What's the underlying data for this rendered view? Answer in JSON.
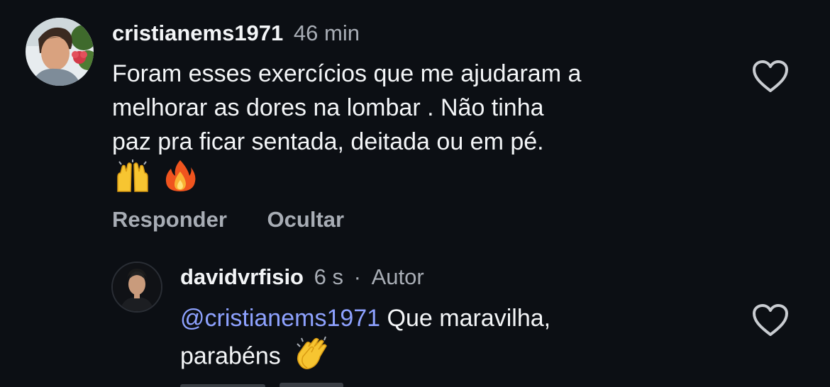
{
  "comments": [
    {
      "username": "cristianems1971",
      "time": "46 min",
      "text_lines": [
        "Foram esses exercícios que me ajudaram a",
        "melhorar as dores na lombar . Não tinha",
        "paz pra ficar sentada, deitada ou em pé."
      ],
      "emojis": [
        "raising-hands-emoji",
        "fire-emoji"
      ],
      "actions": {
        "reply": "Responder",
        "hide": "Ocultar"
      },
      "like_icon": "heart-outline-icon"
    },
    {
      "username": "davidvrfisio",
      "time": "6 s",
      "separator": "·",
      "author_tag": "Autor",
      "mention": "@cristianems1971",
      "text_line_1": "Que maravilha,",
      "text_line_2": "parabéns",
      "emojis": [
        "clapping-hands-emoji"
      ],
      "like_icon": "heart-outline-icon"
    }
  ],
  "colors": {
    "background": "#0c0f14",
    "primary_text": "#f3f5f7",
    "secondary_text": "#a8adb5",
    "mention": "#8ea2ff"
  }
}
